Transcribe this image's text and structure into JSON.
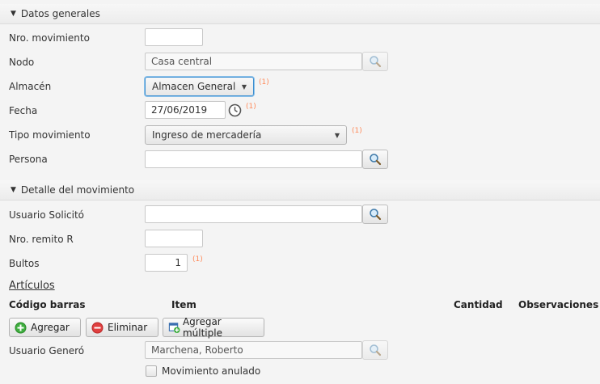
{
  "sections": {
    "general": "Datos generales",
    "detail": "Detalle del movimiento"
  },
  "fields": {
    "nro_movimiento": {
      "label": "Nro. movimiento",
      "value": ""
    },
    "nodo": {
      "label": "Nodo",
      "value": "Casa central"
    },
    "almacen": {
      "label": "Almacén",
      "value": "Almacen General",
      "required": "(1)"
    },
    "fecha": {
      "label": "Fecha",
      "value": "27/06/2019",
      "required": "(1)"
    },
    "tipo_movimiento": {
      "label": "Tipo movimiento",
      "value": "Ingreso de mercadería",
      "required": "(1)"
    },
    "persona": {
      "label": "Persona",
      "value": ""
    },
    "usuario_solicito": {
      "label": "Usuario Solicitó",
      "value": ""
    },
    "nro_remito": {
      "label": "Nro. remito R",
      "value": ""
    },
    "bultos": {
      "label": "Bultos",
      "value": "1",
      "required": "(1)"
    },
    "usuario_genero": {
      "label": "Usuario Generó",
      "value": "Marchena, Roberto"
    }
  },
  "articulos": {
    "title": "Artículos",
    "columns": [
      "Código barras",
      "Item",
      "Cantidad",
      "Observaciones"
    ],
    "buttons": {
      "agregar": "Agregar",
      "eliminar": "Eliminar",
      "agregar_multiple": "Agregar múltiple"
    }
  },
  "movimiento_anulado": {
    "label": "Movimiento anulado",
    "checked": false
  },
  "icons": {
    "search": "search-icon",
    "clock": "clock-icon",
    "add": "add-icon",
    "remove": "remove-icon",
    "add_multiple": "add-multiple-icon"
  },
  "colors": {
    "required": "#ff8a5a",
    "focus": "#3d8fd1",
    "add_green": "#3fae3f",
    "remove_red": "#e04040"
  }
}
